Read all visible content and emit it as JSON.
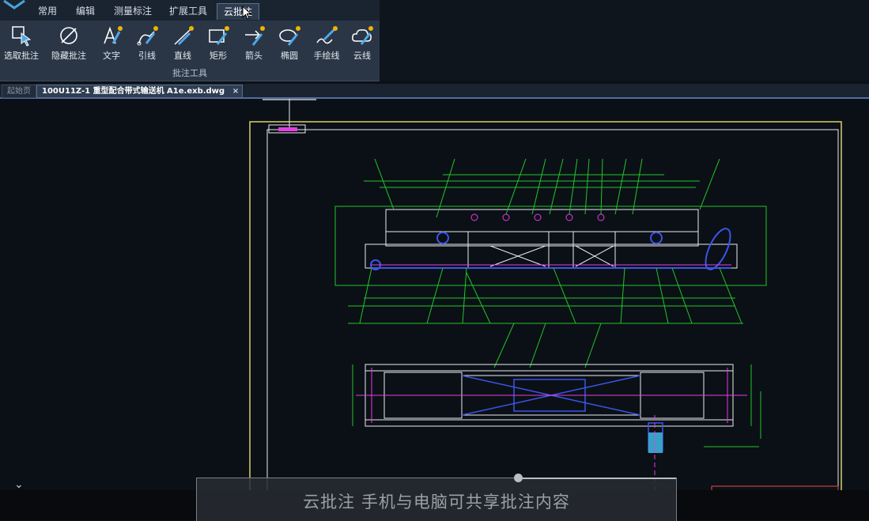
{
  "menu": {
    "tabs": [
      "常用",
      "编辑",
      "测量标注",
      "扩展工具",
      "云批注"
    ],
    "active_tab": "云批注"
  },
  "ribbon": {
    "tools": [
      "选取批注",
      "隐藏批注",
      "文字",
      "引线",
      "直线",
      "矩形",
      "箭头",
      "椭圆",
      "手绘线",
      "云线"
    ],
    "group_label": "批注工具"
  },
  "doc_tabs": {
    "home": "起始页",
    "file": "100U11Z-1 重型配合带式输送机 A1e.exb.dwg",
    "close": "×"
  },
  "caption": {
    "text": "云批注 手机与电脑可共享批注内容"
  },
  "colors": {
    "accent": "#f0b400",
    "frame": "#d9d06a",
    "leader": "#22c52a",
    "outline": "#e8ecf1",
    "blue": "#3a55e8",
    "magenta": "#e63ce6"
  }
}
